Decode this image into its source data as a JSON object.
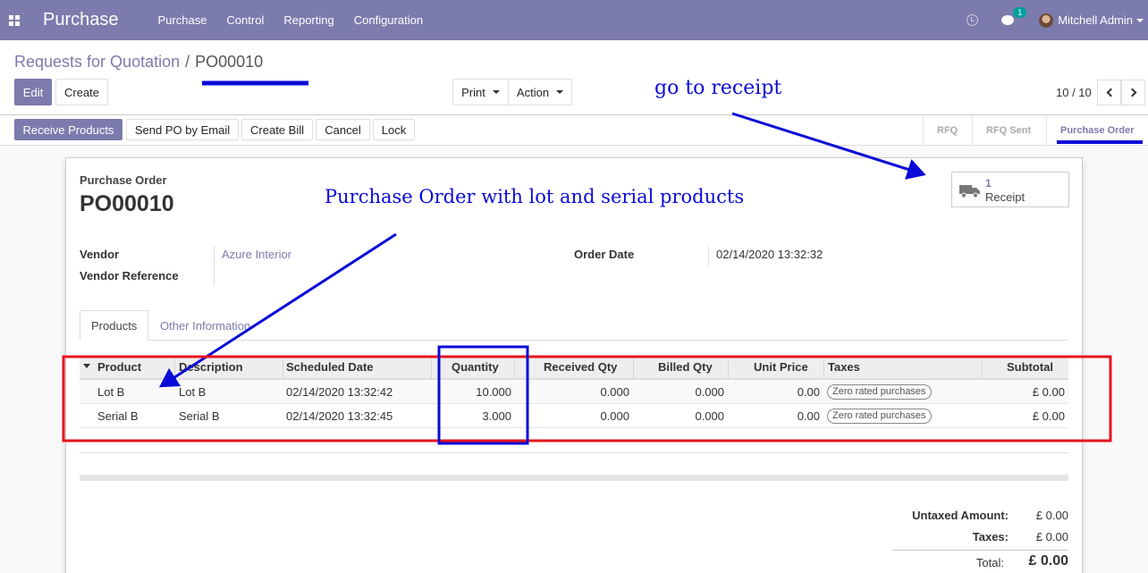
{
  "navbar": {
    "app_title": "Purchase",
    "menu": [
      "Purchase",
      "Control",
      "Reporting",
      "Configuration"
    ],
    "chat_count": "1",
    "user_name": "Mitchell Admin"
  },
  "breadcrumb": {
    "parent": "Requests for Quotation",
    "separator": "/",
    "current": "PO00010"
  },
  "buttons": {
    "edit": "Edit",
    "create": "Create",
    "print": "Print",
    "action": "Action",
    "receive_products": "Receive Products",
    "send_po_email": "Send PO by Email",
    "create_bill": "Create Bill",
    "cancel": "Cancel",
    "lock": "Lock"
  },
  "pager": {
    "value": "10 / 10"
  },
  "status_stages": [
    {
      "label": "RFQ",
      "active": false
    },
    {
      "label": "RFQ Sent",
      "active": false
    },
    {
      "label": "Purchase Order",
      "active": true
    }
  ],
  "document": {
    "type_label": "Purchase Order",
    "name": "PO00010"
  },
  "smart_button": {
    "count": "1",
    "label": "Receipt"
  },
  "fields": {
    "vendor_label": "Vendor",
    "vendor_value": "Azure Interior",
    "vendor_ref_label": "Vendor Reference",
    "order_date_label": "Order Date",
    "order_date_value": "02/14/2020 13:32:32"
  },
  "tabs": [
    "Products",
    "Other Information"
  ],
  "table": {
    "headers": [
      "Product",
      "Description",
      "Scheduled Date",
      "Quantity",
      "Received Qty",
      "Billed Qty",
      "Unit Price",
      "Taxes",
      "Subtotal"
    ],
    "rows": [
      {
        "product": "Lot B",
        "description": "Lot B",
        "scheduled_date": "02/14/2020 13:32:42",
        "quantity": "10.000",
        "received_qty": "0.000",
        "billed_qty": "0.000",
        "unit_price": "0.00",
        "taxes": "Zero rated purchases",
        "subtotal": "£ 0.00"
      },
      {
        "product": "Serial B",
        "description": "Serial B",
        "scheduled_date": "02/14/2020 13:32:45",
        "quantity": "3.000",
        "received_qty": "0.000",
        "billed_qty": "0.000",
        "unit_price": "0.00",
        "taxes": "Zero rated purchases",
        "subtotal": "£ 0.00"
      }
    ]
  },
  "totals": {
    "untaxed_label": "Untaxed Amount:",
    "untaxed_value": "£ 0.00",
    "taxes_label": "Taxes:",
    "taxes_value": "£ 0.00",
    "total_label": "Total:",
    "total_value": "£ 0.00"
  },
  "annotations": {
    "go_to_receipt": "go to receipt",
    "po_with_lot_serial": "Purchase Order with lot and serial products",
    "color_blue": "#0a0ad8",
    "color_red": "#e8141c"
  },
  "colors": {
    "brand": "#7c7bad"
  }
}
